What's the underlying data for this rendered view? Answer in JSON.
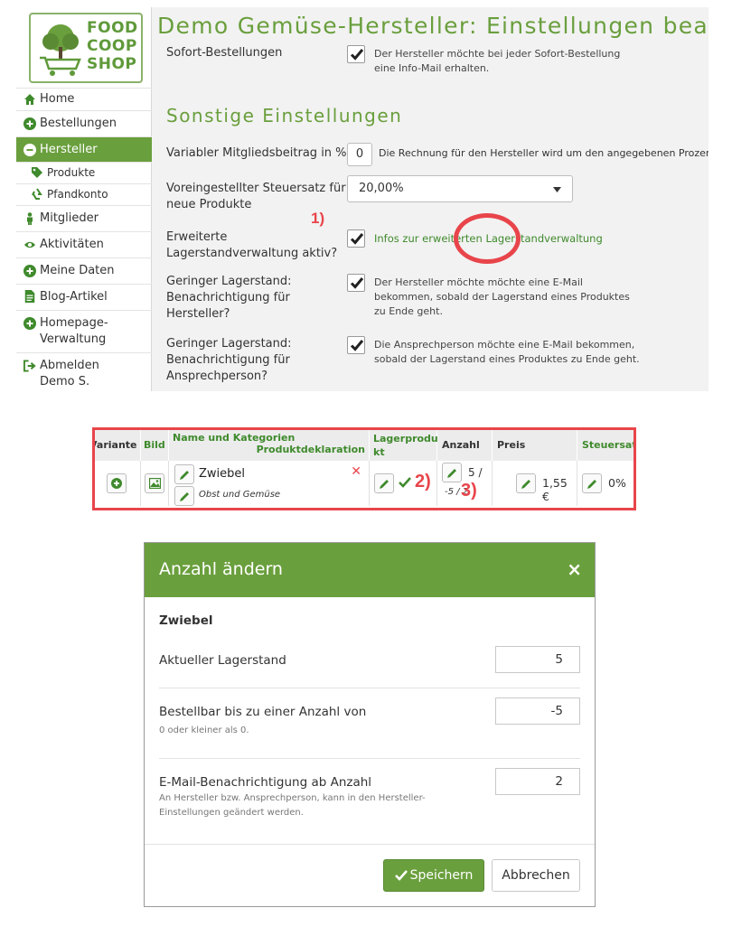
{
  "colors": {
    "brand_green": "#6a9f3d",
    "annotation_red": "#e8454b",
    "link_green": "#3f8a2c"
  },
  "logo": {
    "line1": "FOOD",
    "line2": "COOP",
    "line3": "SHOP"
  },
  "sidebar": {
    "items": [
      {
        "label": "Home",
        "icon": "home-icon"
      },
      {
        "label": "Bestellungen",
        "icon": "plus-circle-icon"
      },
      {
        "label": "Hersteller",
        "icon": "minus-circle-icon",
        "active": true
      },
      {
        "label": "Mitglieder",
        "icon": "person-icon"
      },
      {
        "label": "Aktivitäten",
        "icon": "eye-icon"
      },
      {
        "label": "Meine Daten",
        "icon": "plus-circle-icon"
      },
      {
        "label": "Blog-Artikel",
        "icon": "document-icon"
      },
      {
        "label_line1": "Homepage-",
        "label_line2": "Verwaltung",
        "icon": "plus-circle-icon"
      },
      {
        "label_line1": "Abmelden",
        "label_line2": "Demo S.",
        "icon": "logout-icon"
      }
    ],
    "subitems": [
      {
        "label": "Produkte",
        "icon": "tags-icon"
      },
      {
        "label": "Pfandkonto",
        "icon": "recycle-icon"
      }
    ]
  },
  "settings": {
    "title": "Demo Gemüse-Hersteller: Einstellungen bearbeiten",
    "sofort": {
      "label": "Sofort-Bestellungen",
      "checked": true,
      "desc_line1": "Der Hersteller möchte bei jeder Sofort-Bestellung",
      "desc_line2": "eine Info-Mail erhalten."
    },
    "section_title": "Sonstige Einstellungen",
    "fee": {
      "label": "Variabler Mitgliedsbeitrag in %",
      "value": "0",
      "desc": "Die Rechnung für den Hersteller wird um den angegebenen Prozentwert verringert."
    },
    "tax": {
      "label_line1": "Voreingestellter Steuersatz für",
      "label_line2": "neue Produkte",
      "value": "20,00%"
    },
    "stock": {
      "label_line1": "Erweiterte",
      "label_line2": "Lagerstandverwaltung aktiv?",
      "checked": true,
      "link": "Infos zur erweiterten Lagerstandverwaltung",
      "annotation": "1)"
    },
    "low_stock_mfr": {
      "label_line1": "Geringer Lagerstand:",
      "label_line2": "Benachrichtigung für",
      "label_line3": "Hersteller?",
      "checked": true,
      "desc_line1": "Der Hersteller möchte möchte eine E-Mail",
      "desc_line2": "bekommen, sobald der Lagerstand eines Produktes",
      "desc_line3": "zu Ende geht."
    },
    "low_stock_contact": {
      "label_line1": "Geringer Lagerstand:",
      "label_line2": "Benachrichtigung für",
      "label_line3": "Ansprechperson?",
      "checked": true,
      "desc_line1": "Die Ansprechperson möchte eine E-Mail bekommen,",
      "desc_line2": "sobald der Lagerstand eines Produktes zu Ende geht."
    }
  },
  "product_table": {
    "headers": {
      "variante": "Variante",
      "bild": "Bild",
      "name": "Name und Kategorien",
      "deklaration": "Produktdeklaration",
      "lager_line1": "Lagerprodu",
      "lager_line2": "kt",
      "anzahl": "Anzahl",
      "preis": "Preis",
      "steuer": "Steuersatz"
    },
    "row": {
      "name": "Zwiebel",
      "category": "Obst und Gemüse",
      "amount_line1": "5 /",
      "amount_line2": "-5 / 2",
      "price": "1,55 €",
      "tax": "0%",
      "stock_product": true
    },
    "annotations": {
      "a2": "2)",
      "a3": "3)"
    }
  },
  "modal": {
    "title": "Anzahl ändern",
    "close": "×",
    "product": "Zwiebel",
    "fields": [
      {
        "label": "Aktueller Lagerstand",
        "value": "5",
        "help_line1": "",
        "help_line2": ""
      },
      {
        "label": "Bestellbar bis zu einer Anzahl von",
        "value": "-5",
        "help_line1": "0 oder kleiner als 0.",
        "help_line2": ""
      },
      {
        "label": "E-Mail-Benachrichtigung ab Anzahl",
        "value": "2",
        "help_line1": "An Hersteller bzw. Ansprechperson, kann in den Hersteller-",
        "help_line2": "Einstellungen geändert werden."
      }
    ],
    "save": "Speichern",
    "cancel": "Abbrechen"
  }
}
